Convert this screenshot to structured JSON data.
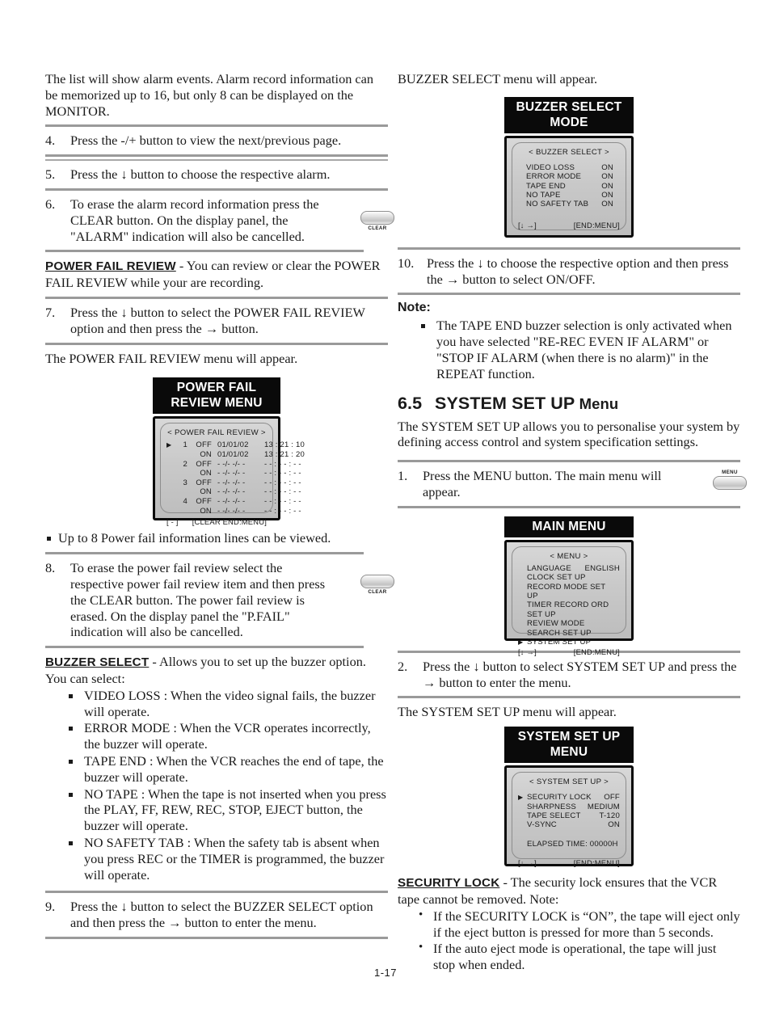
{
  "page": {
    "footer": "1-17"
  },
  "left_column": {
    "intro": "The list will show alarm events.  Alarm record information can be memorized up to 16, but only 8 can be displayed on the MONITOR.",
    "step4": {
      "num": "4.",
      "text": "Press the -/+ button to view the next/previous page."
    },
    "step5": {
      "num": "5.",
      "text": "Press the ↓ button to choose the respective alarm."
    },
    "step6": {
      "num": "6.",
      "text": "To erase the alarm record information press the CLEAR button. On the display panel, the \"ALARM\" indication will also be cancelled."
    },
    "clear_button_1": {
      "label": "CLEAR"
    },
    "power_fail_review": {
      "term": "POWER FAIL REVIEW",
      "description": " - You can review or clear the POWER FAIL REVIEW while your are recording."
    },
    "step7": {
      "num": "7.",
      "text": "Press the ↓ button to select the POWER FAIL REVIEW option and then press the → button."
    },
    "menu_appear": "The POWER FAIL REVIEW menu will appear.",
    "pfr_figure": {
      "title_line1": "POWER FAIL",
      "title_line2": "REVIEW MENU",
      "lcd_title": "< POWER FAIL REVIEW >",
      "rows": [
        {
          "caret": "▶",
          "idx": "1",
          "state": "OFF",
          "date": "01/01/02",
          "time": "13 : 21 : 10"
        },
        {
          "caret": "",
          "idx": "",
          "state": "ON",
          "date": "01/01/02",
          "time": "13 : 21 : 20"
        },
        {
          "caret": "",
          "idx": "2",
          "state": "OFF",
          "date": "- -/- -/- -",
          "time": "- - : - - : - -"
        },
        {
          "caret": "",
          "idx": "",
          "state": "ON",
          "date": "- -/- -/- -",
          "time": "- - : - - : - -"
        },
        {
          "caret": "",
          "idx": "3",
          "state": "OFF",
          "date": "- -/- -/- -",
          "time": "- - : - - : - -"
        },
        {
          "caret": "",
          "idx": "",
          "state": "ON",
          "date": "- -/- -/- -",
          "time": "- - : - - : - -"
        },
        {
          "caret": "",
          "idx": "4",
          "state": "OFF",
          "date": "- -/- -/- -",
          "time": "- - : - - : - -"
        },
        {
          "caret": "",
          "idx": "",
          "state": "ON",
          "date": "- -/- -/- -",
          "time": "- - : - - : - -"
        }
      ],
      "foot_left": "[ - ]",
      "foot_right": "[CLEAR  END:MENU]"
    },
    "pfr_note": "Up to 8 Power fail information lines can be viewed.",
    "step8": {
      "num": "8.",
      "text": "To erase the power fail review select the respective power fail review item and then press the CLEAR button. The power fail review is erased. On the display panel the \"P.FAIL\" indication will also be cancelled."
    },
    "clear_button_2": {
      "label": "CLEAR"
    },
    "buzzer_select": {
      "term": "BUZZER SELECT",
      "description": " - Allows you to set up the buzzer option. You can select:",
      "options": [
        "VIDEO LOSS : When the video signal fails, the buzzer will operate.",
        "ERROR MODE : When the VCR operates incorrectly, the buzzer will operate.",
        "TAPE END : When the VCR reaches the end of tape, the buzzer will operate.",
        "NO TAPE : When the tape is not inserted when you press the PLAY, FF, REW, REC, STOP, EJECT button, the buzzer will operate.",
        "NO SAFETY TAB : When the safety tab is absent when you press REC or the TIMER is programmed, the buzzer will operate."
      ]
    },
    "step9": {
      "num": "9.",
      "text": "Press the ↓ button to select the BUZZER SELECT option and then press the → button to enter the menu."
    }
  },
  "right_column": {
    "buzzer_appear": "BUZZER SELECT menu will appear.",
    "buzzer_figure": {
      "title": "BUZZER SELECT MODE",
      "lcd_title": "< BUZZER SELECT >",
      "rows": [
        {
          "label": "VIDEO  LOSS",
          "value": "ON"
        },
        {
          "label": "ERROR  MODE",
          "value": "ON"
        },
        {
          "label": "TAPE END",
          "value": "ON"
        },
        {
          "label": "NO TAPE",
          "value": "ON"
        },
        {
          "label": "NO SAFETY TAB",
          "value": "ON"
        }
      ],
      "foot_left": "[↓   →]",
      "foot_right": "[END:MENU]"
    },
    "step10": {
      "num": "10.",
      "text": "Press the ↓ to choose the respective option and then press the → button to select ON/OFF."
    },
    "note": {
      "heading": "Note:",
      "text": "The TAPE END buzzer selection is only activated when you have selected \"RE-REC EVEN IF ALARM\" or \"STOP IF ALARM (when there is no alarm)\" in the REPEAT function."
    },
    "section": {
      "number": "6.5",
      "title": "SYSTEM SET UP",
      "title_suffix": "Menu",
      "intro": "The SYSTEM SET UP allows you to personalise your system by defining access control and system specification settings."
    },
    "step1": {
      "num": "1.",
      "text": "Press the MENU button. The main menu will appear."
    },
    "menu_button": {
      "label": "MENU"
    },
    "main_menu_figure": {
      "title": "MAIN MENU",
      "lcd_title": "< MENU >",
      "rows": [
        {
          "caret": "",
          "label": "LANGUAGE",
          "value": "ENGLISH"
        },
        {
          "caret": "",
          "label": "CLOCK  SET  UP",
          "value": ""
        },
        {
          "caret": "",
          "label": "RECORD  MODE  SET  UP",
          "value": ""
        },
        {
          "caret": "",
          "label": "TIMER  RECORD ORD SET  UP",
          "value": ""
        },
        {
          "caret": "",
          "label": "REVIEW  MODE",
          "value": ""
        },
        {
          "caret": "",
          "label": "SEARCH  SET  UP",
          "value": ""
        },
        {
          "caret": "▶",
          "label": "SYSTEM  SET  UP",
          "value": ""
        }
      ],
      "foot_left": "[↓   →]",
      "foot_right": "[END:MENU]"
    },
    "step2": {
      "num": "2.",
      "text": "Press the ↓ button to select SYSTEM SET UP and press the → button to enter the menu."
    },
    "system_appear": "The SYSTEM SET UP menu will appear.",
    "system_figure": {
      "title": "SYSTEM SET UP MENU",
      "lcd_title": "< SYSTEM SET UP >",
      "rows": [
        {
          "caret": "▶",
          "label": "SECURITY  LOCK",
          "value": "OFF"
        },
        {
          "caret": "",
          "label": "SHARPNESS",
          "value": "MEDIUM"
        },
        {
          "caret": "",
          "label": "TAPE  SELECT",
          "value": "T-120"
        },
        {
          "caret": "",
          "label": "V-SYNC",
          "value": "ON"
        }
      ],
      "elapsed": "ELAPSED TIME: 00000H",
      "foot_left": "[↓   →]",
      "foot_right": "[END:MENU]"
    },
    "security_lock": {
      "term": "SECURITY LOCK",
      "description": " - The security lock ensures that the VCR tape cannot be removed.  Note:",
      "bullets": [
        "If the SECURITY LOCK is “ON”, the tape will eject only if the eject button is pressed for more than 5 seconds.",
        "If the auto eject mode is operational, the tape will just stop when ended."
      ]
    }
  }
}
